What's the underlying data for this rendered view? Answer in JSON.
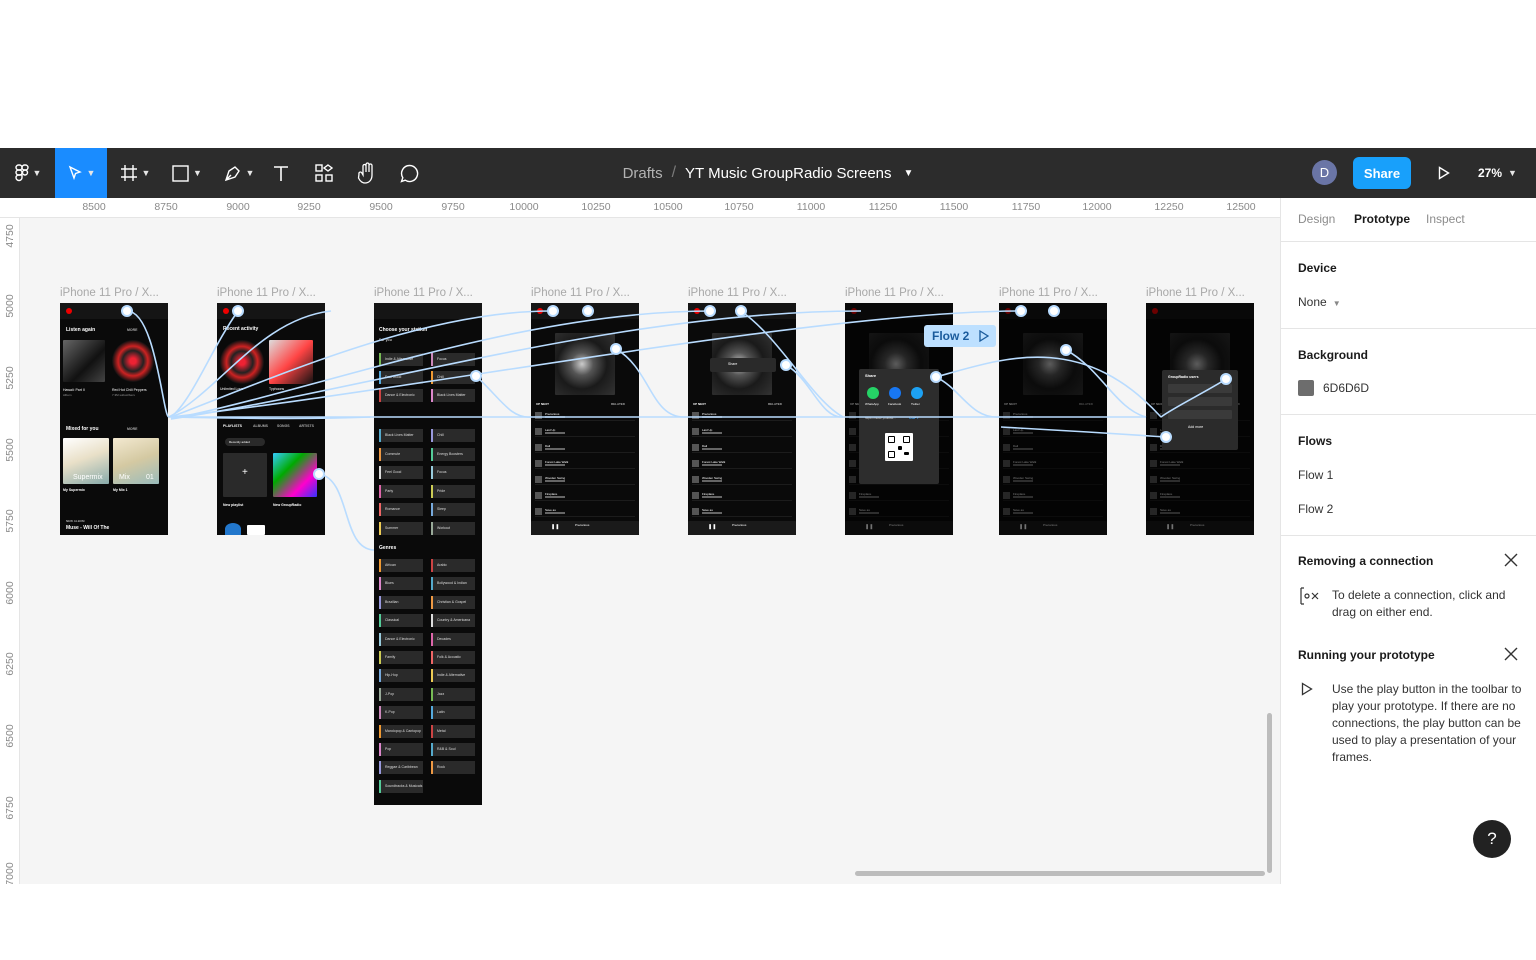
{
  "toolbar": {
    "breadcrumb_root": "Drafts",
    "breadcrumb_separator": "/",
    "file_name": "YT Music GroupRadio Screens",
    "avatar_initial": "D",
    "share_label": "Share",
    "zoom_level": "27%",
    "tools": [
      "figma-menu-icon",
      "move-tool-icon",
      "frame-tool-icon",
      "shape-tool-icon",
      "pen-tool-icon",
      "text-tool-icon",
      "resources-icon",
      "hand-tool-icon",
      "comment-icon"
    ],
    "accent_color": "#18a0fb"
  },
  "ruler": {
    "x_ticks": [
      "8500",
      "8750",
      "9000",
      "9250",
      "9500",
      "9750",
      "10000",
      "10250",
      "10500",
      "10750",
      "11000",
      "11250",
      "11500",
      "11750",
      "12000",
      "12250",
      "12500"
    ],
    "y_ticks": [
      "4750",
      "5000",
      "5250",
      "5500",
      "5750",
      "6000",
      "6250",
      "6500",
      "6750",
      "7000"
    ]
  },
  "canvas": {
    "frame_label": "iPhone 11 Pro / X...",
    "flow_badge": "Flow 2",
    "connector_color": "#b9dcff",
    "frame1": {
      "section1": "Listen again",
      "more1": "MORE",
      "item1": "Hawaii: Part II",
      "item1_sub": "Album",
      "item2": "Red Hot Chili Peppers",
      "item2_sub": "7.3M subscribers",
      "section2": "Mixed for you",
      "more2": "MORE",
      "mix1_art": "Supermix",
      "mix2_art": "Mix",
      "mix2_num": "01",
      "mix1": "My Supermix",
      "mix2": "My Mix 1",
      "album_tag": "NEW ALBUM",
      "album": "Muse - Will Of The"
    },
    "frame2": {
      "section": "Recent activity",
      "item1": "Unlimited Love",
      "item2": "Typhoons",
      "tabs": [
        "PLAYLISTS",
        "ALBUMS",
        "SONGS",
        "ARTISTS"
      ],
      "filter": "Recently added",
      "new_playlist": "New playlist",
      "new_groupradio": "New GroupRadio",
      "plus": "+"
    },
    "frame3": {
      "title": "Choose your station",
      "for_you": "For you",
      "moods": [
        "Indie & Alternative",
        "Focus",
        "Feel Good",
        "Chill",
        "Dance & Electronic",
        "Black Lives Matter",
        "Black Lives Matter",
        "Chill",
        "Commute",
        "Energy Boosters",
        "Feel Good",
        "Focus",
        "Party",
        "Pride",
        "Romance",
        "Sleep",
        "Summer",
        "Workout"
      ],
      "genres_title": "Genres",
      "genres": [
        "African",
        "Arabic",
        "Blues",
        "Bollywood & Indian",
        "Brazilian",
        "Christian & Gospel",
        "Classical",
        "Country & Americana",
        "Dance & Electronic",
        "Decades",
        "Family",
        "Folk & Acoustic",
        "Hip-Hop",
        "Indie & Alternative",
        "J-Pop",
        "Jazz",
        "K-Pop",
        "Latin",
        "Mandopop & Cantopop",
        "Metal",
        "Pop",
        "R&B & Soul",
        "Reggae & Caribbean",
        "Rock",
        "Soundtracks & Musicals"
      ]
    },
    "player": {
      "up_next": "UP NEXT",
      "related": "RELATED",
      "now_playing": "Precarious",
      "songs": [
        "Precarious",
        "Laid Up",
        "Dali",
        "Forest Lake Walk",
        "Wooden Swing",
        "Fireplace",
        "Save as"
      ],
      "share_menu": "Share"
    },
    "frame6": {
      "share_title": "Share",
      "apps": [
        "WhatsApp",
        "Facebook",
        "Twitter"
      ],
      "url": "https://music.youtube...",
      "copy": "COPY"
    },
    "frame8": {
      "sheet_title": "GroupRadio users",
      "add_more": "Add more"
    }
  },
  "panel": {
    "tabs": [
      "Design",
      "Prototype",
      "Inspect"
    ],
    "active_tab": "Prototype",
    "device_title": "Device",
    "device_value": "None",
    "background_title": "Background",
    "background_hex": "6D6D6D",
    "background_color": "#6d6d6d",
    "flows_title": "Flows",
    "flows": [
      "Flow 1",
      "Flow 2"
    ],
    "removing_title": "Removing a connection",
    "removing_text": "To delete a connection, click and drag on either end.",
    "running_title": "Running your prototype",
    "running_text": "Use the play button in the toolbar to play your prototype. If there are no connections, the play button can be used to play a presentation of your frames.",
    "help": "?"
  }
}
